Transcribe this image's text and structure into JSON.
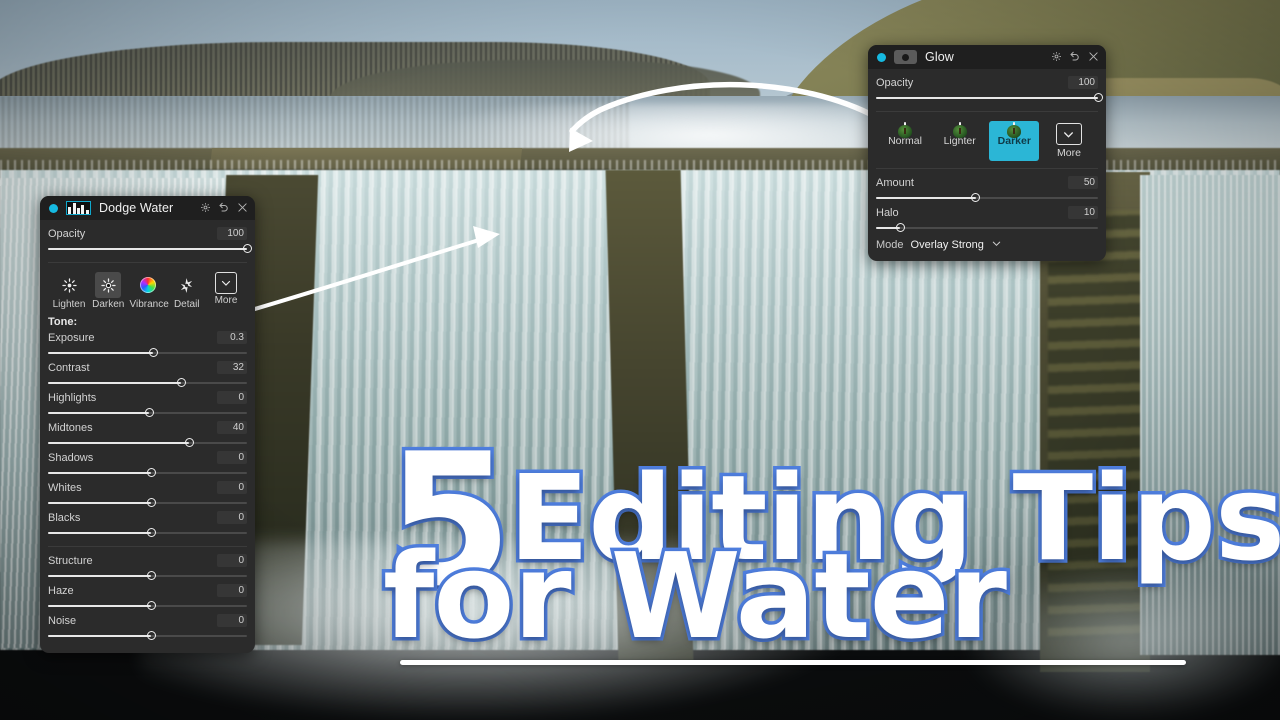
{
  "overlay": {
    "headline_number": "5",
    "headline_line1": "Editing Tips",
    "headline_line2": "for Water",
    "accent_stroke_color": "#4f7fe0",
    "headline_fill_color": "#ffffff",
    "underline_color": "#ffffff"
  },
  "scene": {
    "description": "Long-exposure photograph of a wide weir waterfall spilling from a calm lake, with bare treeline, grassy hillside and a distant building on the far shore"
  },
  "panels": {
    "dodge": {
      "title": "Dodge Water",
      "status_dot_color": "#16b9e0",
      "icons": {
        "settings": "gear-icon",
        "reset": "undo-icon",
        "close": "close-icon"
      },
      "opacity": {
        "label": "Opacity",
        "value": "100",
        "percent": 100
      },
      "tools": [
        {
          "label": "Lighten",
          "icon": "sun-icon",
          "selected": false
        },
        {
          "label": "Darken",
          "icon": "sun-dark-icon",
          "selected": true
        },
        {
          "label": "Vibrance",
          "icon": "color-wheel-icon",
          "selected": false
        },
        {
          "label": "Detail",
          "icon": "sparkle-icon",
          "selected": false
        },
        {
          "label": "More",
          "icon": "chevron-down-icon",
          "selected": false
        }
      ],
      "section_tone": "Tone:",
      "sliders_tone": [
        {
          "label": "Exposure",
          "value": "0.3",
          "percent": 53
        },
        {
          "label": "Contrast",
          "value": "32",
          "percent": 67
        },
        {
          "label": "Highlights",
          "value": "0",
          "percent": 51
        },
        {
          "label": "Midtones",
          "value": "40",
          "percent": 71
        },
        {
          "label": "Shadows",
          "value": "0",
          "percent": 52
        },
        {
          "label": "Whites",
          "value": "0",
          "percent": 52
        },
        {
          "label": "Blacks",
          "value": "0",
          "percent": 52
        }
      ],
      "sliders_detail": [
        {
          "label": "Structure",
          "value": "0",
          "percent": 52
        },
        {
          "label": "Haze",
          "value": "0",
          "percent": 52
        },
        {
          "label": "Noise",
          "value": "0",
          "percent": 52
        }
      ]
    },
    "glow": {
      "title": "Glow",
      "status_dot_color": "#16b9e0",
      "icons": {
        "settings": "gear-icon",
        "reset": "undo-icon",
        "close": "close-icon"
      },
      "opacity": {
        "label": "Opacity",
        "value": "100",
        "percent": 100
      },
      "presets": [
        {
          "label": "Normal",
          "selected": false
        },
        {
          "label": "Lighter",
          "selected": false
        },
        {
          "label": "Darker",
          "selected": true
        },
        {
          "label": "More",
          "selected": false,
          "icon": "chevron-down-icon"
        }
      ],
      "preset_selected_color": "#2bb6d6",
      "sliders": [
        {
          "label": "Amount",
          "value": "50",
          "percent": 45
        },
        {
          "label": "Halo",
          "value": "10",
          "percent": 11
        }
      ],
      "mode": {
        "label": "Mode",
        "value": "Overlay Strong",
        "caret": "chevron-down-icon"
      }
    }
  },
  "annotations": {
    "arrow_top": "curved-arrow-pointing-left-from-glow-panel",
    "arrow_left": "curved-arrow-pointing-right-from-dodge-panel",
    "arrow_color": "#ffffff"
  }
}
